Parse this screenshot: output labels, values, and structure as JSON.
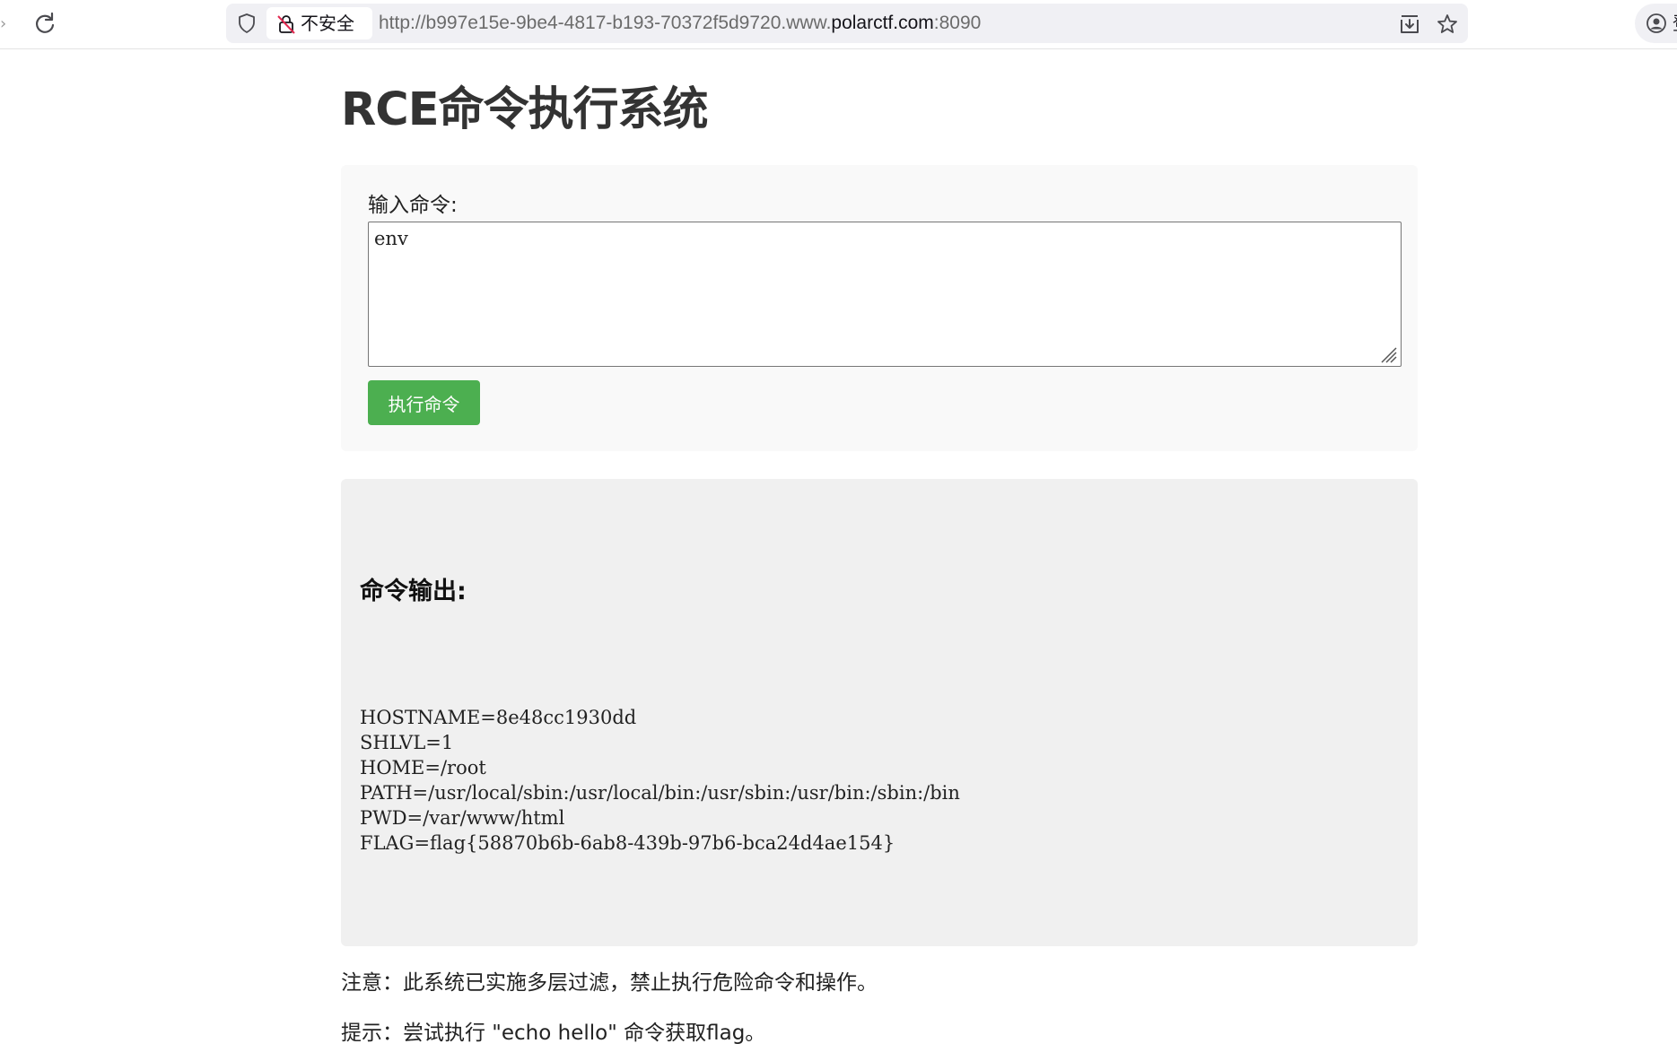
{
  "browser": {
    "security_label": "不安全",
    "url_prefix": "http://b997e15e-9be4-4817-b193-70372f5d9720.www.",
    "url_domain": "polarctf.com",
    "url_suffix": ":8090",
    "account_label": "登"
  },
  "page": {
    "title": "RCE命令执行系统",
    "form": {
      "label": "输入命令:",
      "command_value": "env",
      "submit_label": "执行命令"
    },
    "output": {
      "heading": "命令输出:",
      "lines": "HOSTNAME=8e48cc1930dd\nSHLVL=1\nHOME=/root\nPATH=/usr/local/sbin:/usr/local/bin:/usr/sbin:/usr/bin:/sbin:/bin\nPWD=/var/www/html\nFLAG=flag{58870b6b-6ab8-439b-97b6-bca24d4ae154}"
    },
    "note": "注意：此系统已实施多层过滤，禁止执行危险命令和操作。",
    "hint": "提示：尝试执行 \"echo hello\" 命令获取flag。"
  },
  "colors": {
    "button_bg": "#4caf50",
    "form_bg": "#f9f9f9",
    "output_bg": "#f0f0f0",
    "title_color": "#333333"
  }
}
